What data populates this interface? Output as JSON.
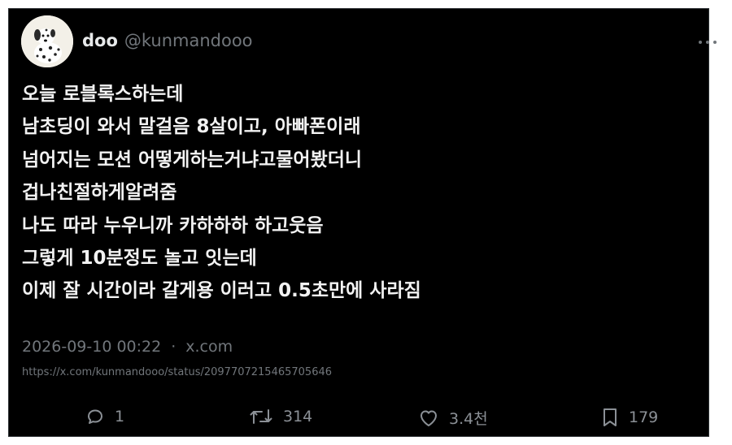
{
  "user": {
    "display_name": "doo",
    "handle": "@kunmandooo"
  },
  "tweet": {
    "lines": [
      "오늘 로블록스하는데",
      "남초딩이 와서 말걸음 8살이고, 아빠폰이래",
      "넘어지는 모션 어떻게하는거냐고물어봤더니",
      "겁나친절하게알려줌",
      "나도 따라 누우니까 카하하하 하고웃음",
      "그렇게 10분정도 놀고 잇는데",
      "이제 잘 시간이라 갈게용 이러고 0.5초만에 사라짐"
    ]
  },
  "meta": {
    "timestamp": "2026-09-10 00:22",
    "separator": "·",
    "source": "x.com",
    "url": "https://x.com/kunmandooo/status/2097707215465705646"
  },
  "actions": {
    "replies": "1",
    "retweets": "314",
    "likes": "3.4천",
    "bookmarks": "179"
  },
  "icons": {
    "more": "more-horizontal-icon",
    "reply": "reply-icon",
    "retweet": "retweet-icon",
    "like": "heart-icon",
    "bookmark": "bookmark-icon"
  },
  "colors": {
    "background": "#000000",
    "text": "#e7e9ea",
    "muted": "#71767b"
  }
}
